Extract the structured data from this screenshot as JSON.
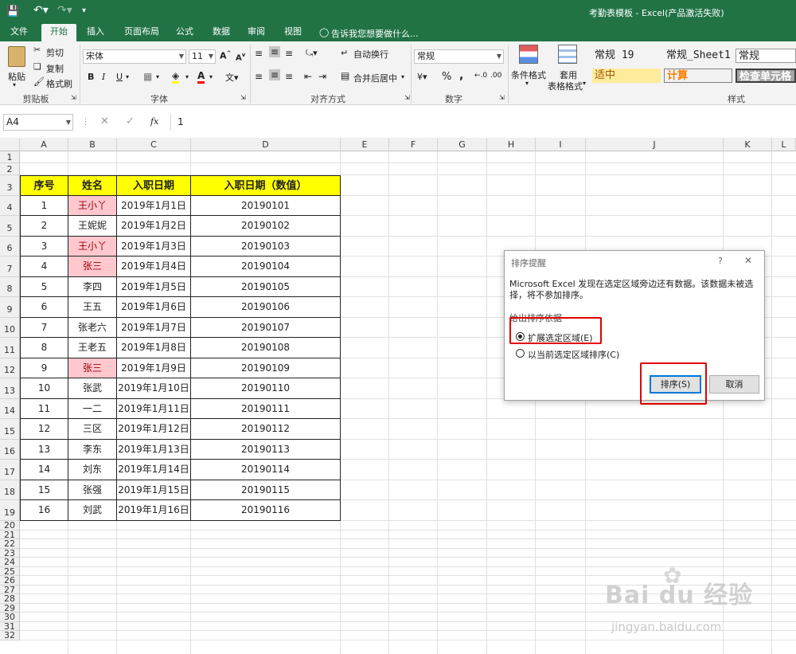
{
  "window": {
    "title": "考勤表模板 - Excel(产品激活失败)"
  },
  "tabs": [
    {
      "label": "文件",
      "active": false
    },
    {
      "label": "开始",
      "active": true
    },
    {
      "label": "插入",
      "active": false
    },
    {
      "label": "页面布局",
      "active": false
    },
    {
      "label": "公式",
      "active": false
    },
    {
      "label": "数据",
      "active": false
    },
    {
      "label": "审阅",
      "active": false
    },
    {
      "label": "视图",
      "active": false
    }
  ],
  "tellme": "告诉我您想要做什么...",
  "ribbon": {
    "clipboard": {
      "paste": "粘贴",
      "cut": "剪切",
      "copy": "复制",
      "format_painter": "格式刷",
      "label": "剪贴板"
    },
    "font": {
      "name": "宋体",
      "size": "11",
      "bold": "B",
      "italic": "I",
      "underline": "U",
      "label": "字体"
    },
    "alignment": {
      "wrap": "自动换行",
      "merge": "合并后居中",
      "label": "对齐方式"
    },
    "number": {
      "format": "常规",
      "percent": "%",
      "comma": ",",
      "label": "数字"
    },
    "styles": {
      "conditional": "条件格式",
      "table_line1": "套用",
      "table_line2": "表格格式",
      "gallery": [
        "常规 19",
        "常规_Sheet1",
        "常规",
        "适中",
        "计算",
        "检查单元格"
      ],
      "label": "样式"
    }
  },
  "formula_bar": {
    "name_box": "A4",
    "fx": "fx",
    "value": "1"
  },
  "columns": [
    "A",
    "B",
    "C",
    "D",
    "E",
    "F",
    "G",
    "H",
    "I",
    "J",
    "K",
    "L"
  ],
  "table": {
    "headers": [
      "序号",
      "姓名",
      "入职日期",
      "入职日期（数值）"
    ],
    "rows": [
      [
        "1",
        "王小丫",
        "2019年1月1日",
        "20190101"
      ],
      [
        "2",
        "王妮妮",
        "2019年1月2日",
        "20190102"
      ],
      [
        "3",
        "王小丫",
        "2019年1月3日",
        "20190103"
      ],
      [
        "4",
        "张三",
        "2019年1月4日",
        "20190104"
      ],
      [
        "5",
        "李四",
        "2019年1月5日",
        "20190105"
      ],
      [
        "6",
        "王五",
        "2019年1月6日",
        "20190106"
      ],
      [
        "7",
        "张老六",
        "2019年1月7日",
        "20190107"
      ],
      [
        "8",
        "王老五",
        "2019年1月8日",
        "20190108"
      ],
      [
        "9",
        "张三",
        "2019年1月9日",
        "20190109"
      ],
      [
        "10",
        "张武",
        "2019年1月10日",
        "20190110"
      ],
      [
        "11",
        "一二",
        "2019年1月11日",
        "20190111"
      ],
      [
        "12",
        "三区",
        "2019年1月12日",
        "20190112"
      ],
      [
        "13",
        "李东",
        "2019年1月13日",
        "20190113"
      ],
      [
        "14",
        "刘东",
        "2019年1月14日",
        "20190114"
      ],
      [
        "15",
        "张强",
        "2019年1月15日",
        "20190115"
      ],
      [
        "16",
        "刘武",
        "2019年1月16日",
        "20190116"
      ]
    ],
    "duplicate_rows": [
      1,
      3,
      4,
      9
    ]
  },
  "dialog": {
    "title": "排序提醒",
    "help": "?",
    "close": "✕",
    "message": "Microsoft Excel 发现在选定区域旁边还有数据。该数据未被选择，将不参加排序。",
    "group_label": "给出排序依据",
    "option1": "扩展选定区域(E)",
    "option2": "以当前选定区域排序(C)",
    "sort_button": "排序(S)",
    "cancel_button": "取消"
  },
  "watermark": {
    "brand": "Bai du 经验",
    "url": "jingyan.baidu.com"
  },
  "colors": {
    "excel_green": "#217346",
    "header_yellow": "#ffff00",
    "dup_fill": "#ffc7ce",
    "dup_text": "#9c0006",
    "highlight_red": "#e00000"
  }
}
